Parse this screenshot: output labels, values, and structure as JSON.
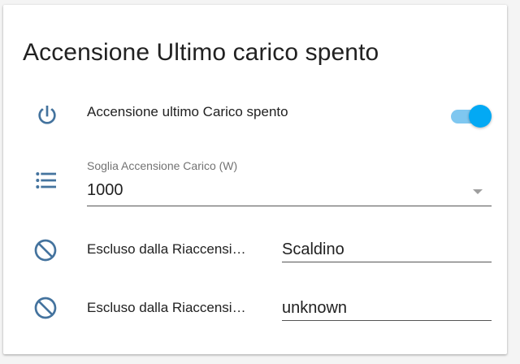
{
  "card": {
    "title": "Accensione Ultimo carico spento"
  },
  "rows": [
    {
      "icon": "power-icon",
      "label": "Accensione ultimo Carico spento",
      "toggle_on": true
    },
    {
      "icon": "list-icon",
      "field_label": "Soglia Accensione Carico (W)",
      "value": "1000"
    },
    {
      "icon": "cancel-icon",
      "label": "Escluso dalla Riaccensi…",
      "value": "Scaldino"
    },
    {
      "icon": "cancel-icon",
      "label": "Escluso dalla Riaccensi…",
      "value": "unknown"
    }
  ],
  "colors": {
    "icon": "#44739e",
    "accent": "#03a9f4",
    "accent_track": "#7fc7f0"
  }
}
